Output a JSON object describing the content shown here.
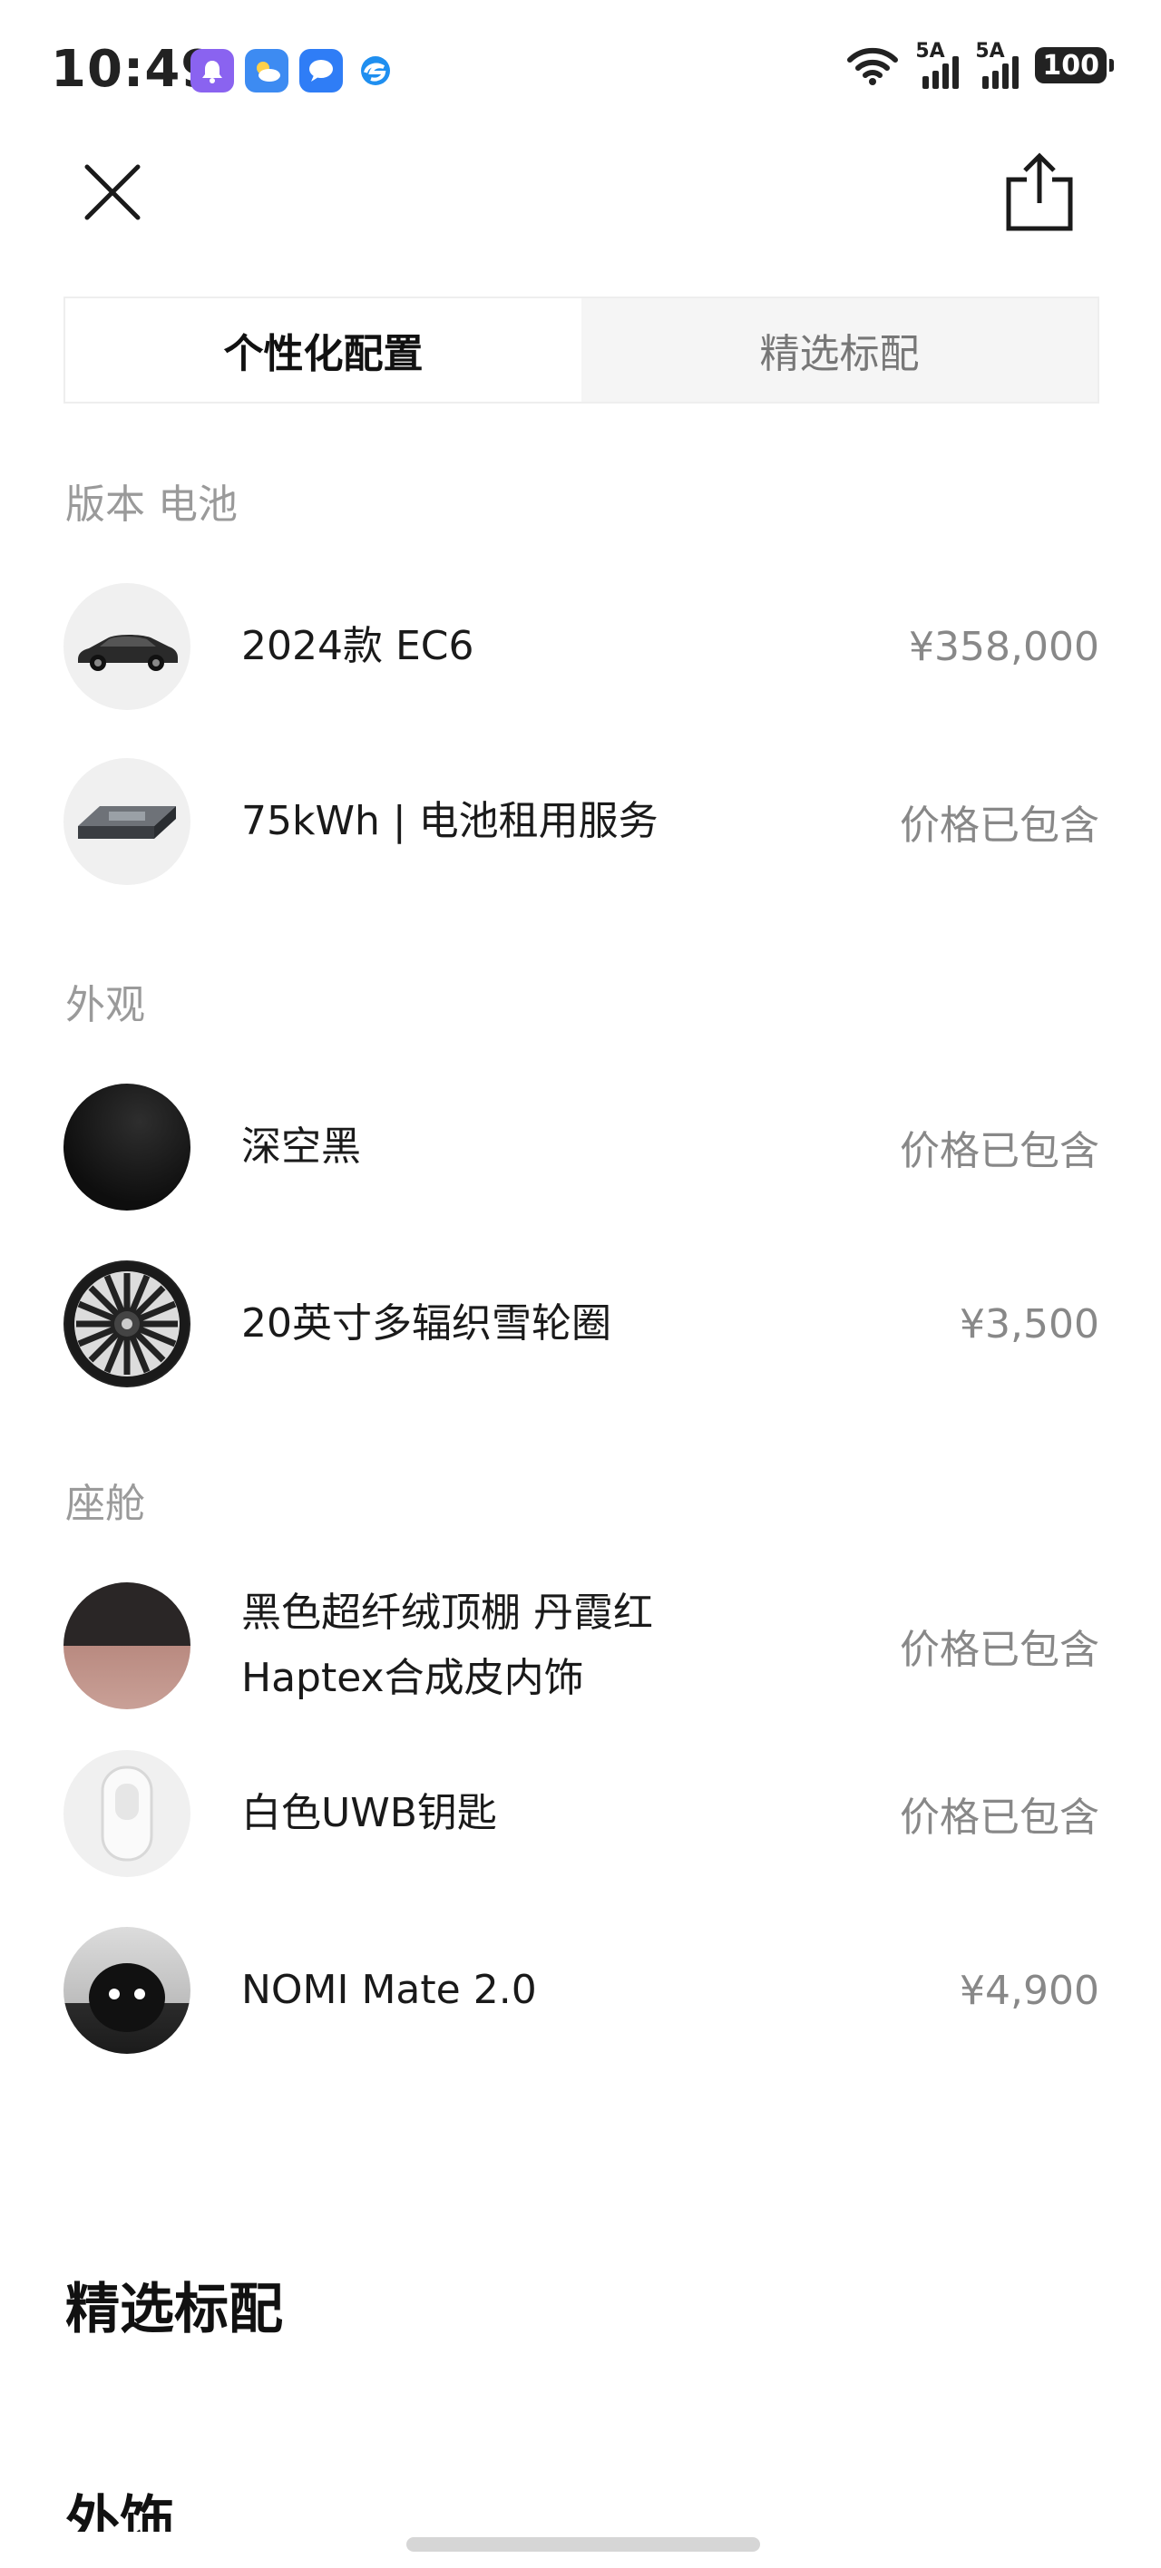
{
  "status_bar": {
    "time": "10:49",
    "notif_icons": [
      "bell-app-icon",
      "weather-app-icon",
      "message-app-icon",
      "browser-app-icon"
    ],
    "signal_1": "5A",
    "signal_2": "5A",
    "battery": "100"
  },
  "tabs": {
    "personal": "个性化配置",
    "standard": "精选标配",
    "active": "personal"
  },
  "sections": {
    "version_battery": "版本 电池",
    "exterior": "外观",
    "cabin": "座舱"
  },
  "items": {
    "model": {
      "label": "2024款 EC6",
      "price": "¥358,000"
    },
    "battery": {
      "label": "75kWh | 电池租用服务",
      "price": "价格已包含"
    },
    "paint": {
      "label": "深空黑",
      "price": "价格已包含"
    },
    "wheels": {
      "label": "20英寸多辐织雪轮圈",
      "price": "¥3,500"
    },
    "interior": {
      "label_line1": "黑色超纤绒顶棚 丹霞红",
      "label_line2": "Haptex合成皮内饰",
      "price": "价格已包含"
    },
    "key": {
      "label": "白色UWB钥匙",
      "price": "价格已包含"
    },
    "nomi": {
      "label": "NOMI Mate 2.0",
      "price": "¥4,900"
    }
  },
  "standard_section": {
    "heading": "精选标配",
    "sub_heading": "外饰"
  },
  "colors": {
    "accent_text": "#1a1a1a",
    "muted": "#9a9a9a",
    "interior_red": "#b98a80"
  }
}
